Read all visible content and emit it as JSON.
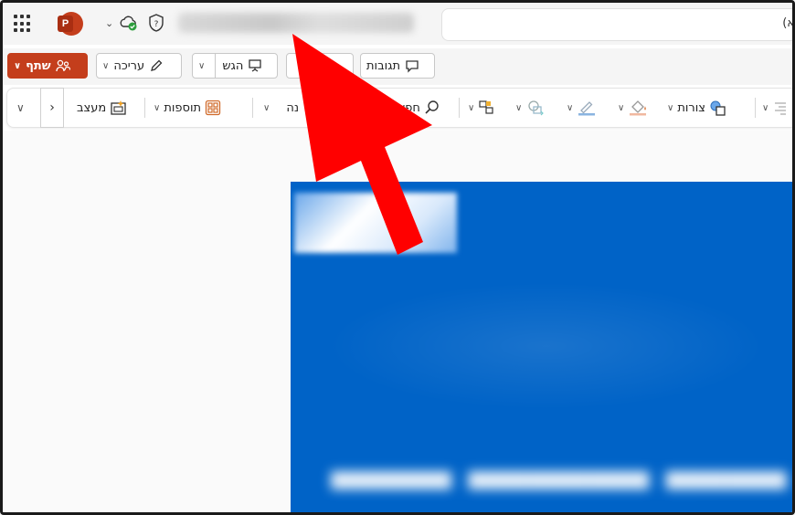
{
  "app": {
    "logo_letter": "P",
    "search_tail": "(א"
  },
  "commands": {
    "share_label": "שתף",
    "edit_label": "עריכה",
    "present_label": "הגש",
    "comments_label": "תגובות"
  },
  "ribbon": {
    "designer_label": "מעצב",
    "addins_label": "תוספות",
    "partial_label": "נה",
    "search_partial": "חפש",
    "shapes_label": "צורות"
  },
  "colors": {
    "accent": "#c43e1c",
    "slide_bg": "#0063c7",
    "arrow": "#ff0000"
  },
  "icons": [
    "waffle-icon",
    "cloud-sync-icon",
    "shield-icon",
    "person-share-icon",
    "pencil-icon",
    "presentation-icon",
    "comment-icon",
    "search-icon",
    "designer-icon",
    "addins-icon",
    "shapes-icon"
  ]
}
